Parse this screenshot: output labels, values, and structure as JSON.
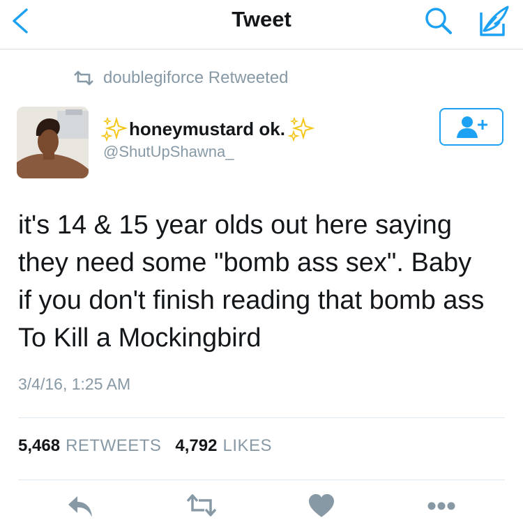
{
  "nav": {
    "title": "Tweet",
    "back_icon": "chevron-left-icon",
    "search_icon": "search-icon",
    "compose_icon": "compose-feather-icon",
    "accent_color": "#1da1f2"
  },
  "retweet_context": {
    "icon": "retweet-icon",
    "text": "doublegiforce Retweeted"
  },
  "author": {
    "display_name": "honeymustard ok.",
    "handle": "@ShutUpShawna_",
    "name_decoration_icon": "sparkles-icon",
    "follow_icon": "add-user-icon"
  },
  "tweet": {
    "lines": [
      "it's 14 & 15 year olds out here saying",
      "they need some \"bomb ass sex\". Baby",
      "if you don't finish reading that bomb ass",
      "To Kill a Mockingbird"
    ],
    "timestamp": "3/4/16, 1:25 AM"
  },
  "stats": {
    "retweets_count": "5,468",
    "retweets_label": "RETWEETS",
    "likes_count": "4,792",
    "likes_label": "LIKES"
  },
  "actions": [
    {
      "icon": "reply-icon"
    },
    {
      "icon": "retweet-icon"
    },
    {
      "icon": "heart-icon"
    },
    {
      "icon": "more-dots-icon"
    }
  ],
  "colors": {
    "secondary_text": "#8899a6",
    "primary_text": "#14171a",
    "divider": "#e1e8ed",
    "sparkle": "#f5c518"
  }
}
